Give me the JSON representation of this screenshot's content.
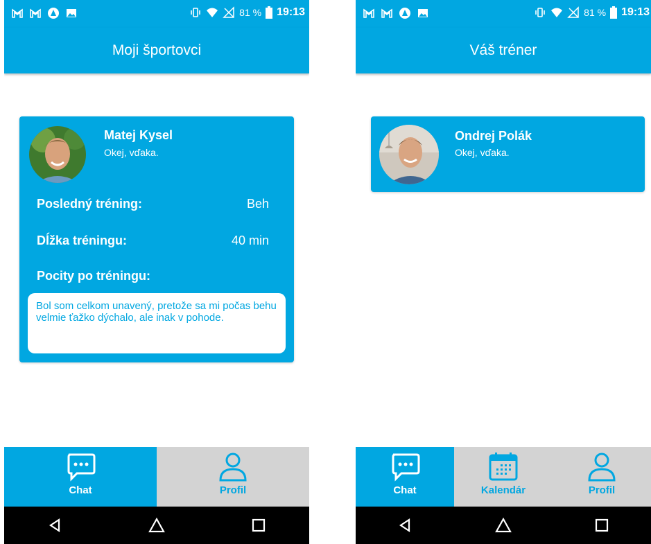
{
  "status_bar": {
    "battery": "81 %",
    "time": "19:13"
  },
  "left_screen": {
    "title": "Moji športovci",
    "athlete": {
      "name": "Matej Kysel",
      "last_message": "Okej, vďaka.",
      "last_training_label": "Posledný tréning:",
      "last_training_value": "Beh",
      "duration_label": "Dĺžka tréningu:",
      "duration_value": "40 min",
      "feelings_label": "Pocity po tréningu:",
      "feelings_text": "Bol som celkom unavený, pretože sa mi počas behu velmie ťažko dýchalo, ale inak v pohode."
    },
    "nav": [
      {
        "label": "Chat",
        "icon": "chat-icon",
        "active": true
      },
      {
        "label": "Profil",
        "icon": "profile-icon",
        "active": false
      }
    ]
  },
  "right_screen": {
    "title": "Váš tréner",
    "coach": {
      "name": "Ondrej Polák",
      "last_message": "Okej, vďaka."
    },
    "nav": [
      {
        "label": "Chat",
        "icon": "chat-icon",
        "active": true
      },
      {
        "label": "Kalendár",
        "icon": "calendar-icon",
        "active": false
      },
      {
        "label": "Profil",
        "icon": "profile-icon",
        "active": false
      }
    ]
  },
  "colors": {
    "accent": "#01a7e1",
    "inactive_tab": "#d3d3d3",
    "system_nav": "#000000"
  }
}
